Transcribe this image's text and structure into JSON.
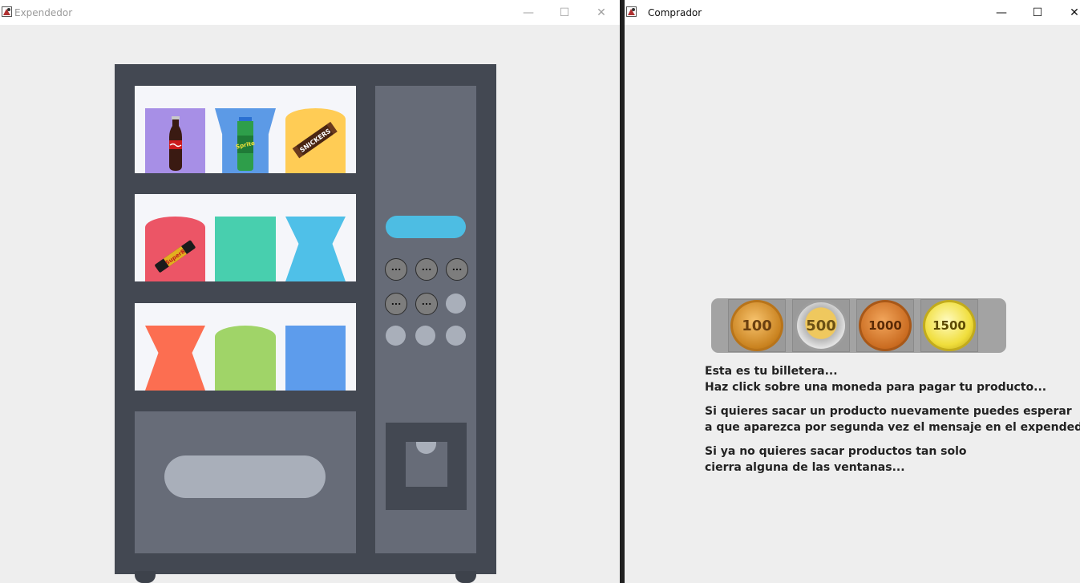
{
  "left_window": {
    "title": "Expendedor",
    "controls": {
      "minimize": "—",
      "maximize": "☐",
      "close": "✕"
    },
    "keypad_buttons": [
      "...",
      "...",
      "...",
      "...",
      "..."
    ],
    "colors": {
      "machine": "#434852",
      "panel": "#666b77",
      "display": "#4dbde3",
      "shelf": "#f5f6fa",
      "slot": "#a9afba"
    },
    "products": [
      {
        "shelf": 1,
        "color": "#a78fe6",
        "shape": "box",
        "item": "Coca-Cola"
      },
      {
        "shelf": 1,
        "color": "#5c9ae6",
        "shape": "bottle",
        "item": "Sprite"
      },
      {
        "shelf": 1,
        "color": "#ffcc55",
        "shape": "can",
        "item": "Snickers"
      },
      {
        "shelf": 2,
        "color": "#ec5566",
        "shape": "can",
        "item": "Super 8"
      },
      {
        "shelf": 2,
        "color": "#48cfae",
        "shape": "box"
      },
      {
        "shelf": 2,
        "color": "#4fc0e8",
        "shape": "hourglass"
      },
      {
        "shelf": 3,
        "color": "#fc6e51",
        "shape": "hourglass"
      },
      {
        "shelf": 3,
        "color": "#a0d468",
        "shape": "can"
      },
      {
        "shelf": 3,
        "color": "#5d9cec",
        "shape": "box"
      }
    ]
  },
  "right_window": {
    "title": "Comprador",
    "controls": {
      "minimize": "—",
      "maximize": "☐",
      "close": "✕"
    },
    "wallet": {
      "coins": [
        {
          "label": "100",
          "icon": "coin-100-icon"
        },
        {
          "label": "500",
          "icon": "coin-500-icon"
        },
        {
          "label": "1000",
          "icon": "coin-1000-icon"
        },
        {
          "label": "1500",
          "icon": "coin-1500-icon"
        }
      ]
    },
    "messages": [
      "Esta es tu billetera...",
      "Haz click sobre una moneda para pagar tu producto...",
      "Si quieres sacar un producto nuevamente puedes esperar",
      "a que aparezca por segunda vez el mensaje en el expendedor...",
      "Si ya no quieres sacar productos tan solo",
      "cierra alguna de las ventanas..."
    ]
  }
}
